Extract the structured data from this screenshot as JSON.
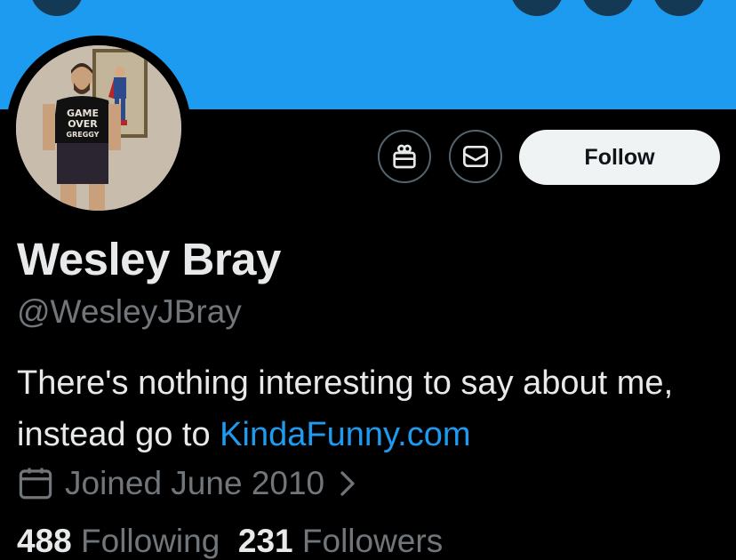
{
  "profile": {
    "name": "Wesley Bray",
    "handle": "@WesleyJBray",
    "bio_text": "There's nothing interesting to say about me, instead go to ",
    "bio_link": "KindaFunny.com",
    "joined": "Joined June 2010"
  },
  "actions": {
    "follow_label": "Follow",
    "gift_icon": "gift-icon",
    "message_icon": "envelope-icon"
  },
  "stats": {
    "following_count": "488",
    "following_label": "Following",
    "followers_count": "231",
    "followers_label": "Followers"
  },
  "avatar": {
    "shirt_text": [
      "GAME",
      "OVER",
      "GREGGY"
    ]
  },
  "colors": {
    "banner": "#1d9bf0",
    "link": "#1d9bf0",
    "background": "#000000",
    "primary_text": "#e7e9ea",
    "secondary_text": "#71767b"
  }
}
